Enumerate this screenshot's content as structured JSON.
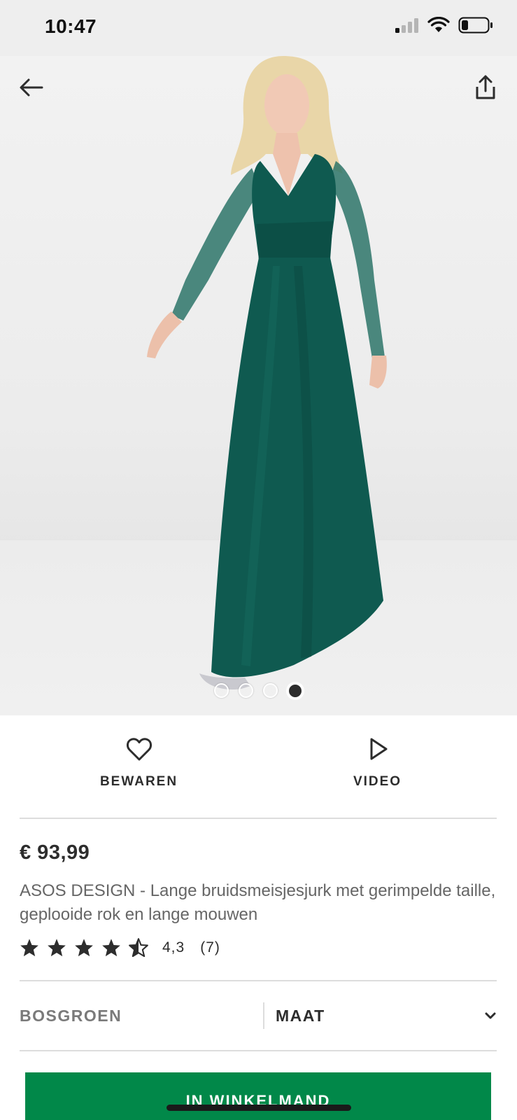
{
  "status_bar": {
    "time": "10:47"
  },
  "hero": {
    "image_icon": "product-photo-green-maxi-dress",
    "carousel_pages": 4,
    "carousel_active_index": 4
  },
  "nav": {
    "back_icon": "arrow-left-icon",
    "share_icon": "share-icon"
  },
  "actions": [
    {
      "icon": "heart-icon",
      "label": "BEWAREN"
    },
    {
      "icon": "play-icon",
      "label": "VIDEO"
    }
  ],
  "product": {
    "price": "€ 93,99",
    "title": "ASOS DESIGN - Lange bruidsmeisjesjurk met gerimpelde taille, geplooide rok en lange mouwen",
    "rating_value": "4,3",
    "rating_count": "(7)",
    "rating_stars": 4.3
  },
  "selectors": {
    "colour": "BOSGROEN",
    "size": "MAAT"
  },
  "cart": {
    "label": "IN WINKELMAND"
  },
  "colors": {
    "cart_button": "#018849",
    "dress": "#0f5a50",
    "text_primary": "#2d2d2d",
    "text_secondary": "#666666"
  }
}
